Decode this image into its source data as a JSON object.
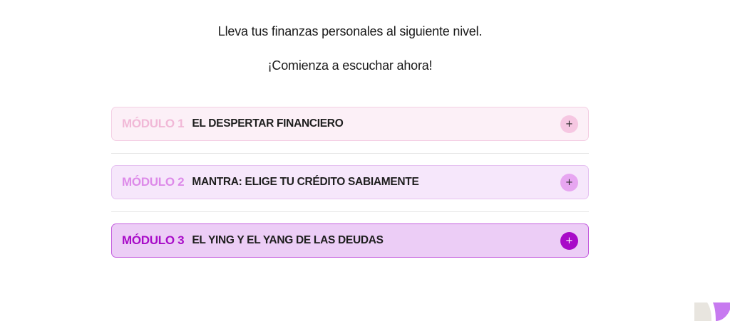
{
  "intro": {
    "line1": "Lleva tus finanzas personales al siguiente nivel.",
    "line2": "¡Comienza a escuchar ahora!"
  },
  "modules": [
    {
      "number": "MÓDULO 1",
      "title": "EL DESPERTAR FINANCIERO",
      "toggle": "+"
    },
    {
      "number": "MÓDULO 2",
      "title": "MANTRA: ELIGE TU CRÉDITO SABIAMENTE",
      "toggle": "+"
    },
    {
      "number": "MÓDULO 3",
      "title": "EL YING Y EL YANG DE LAS DEUDAS",
      "toggle": "+"
    }
  ],
  "colors": {
    "module1_accent": "#f1b8d7",
    "module2_accent": "#dd8ae9",
    "module3_accent": "#a80bc8",
    "logo_left": "#e8e5df",
    "logo_right": "#c77af0"
  },
  "icons": {
    "toggle": "plus-icon",
    "logo": "brand-logo-icon"
  }
}
